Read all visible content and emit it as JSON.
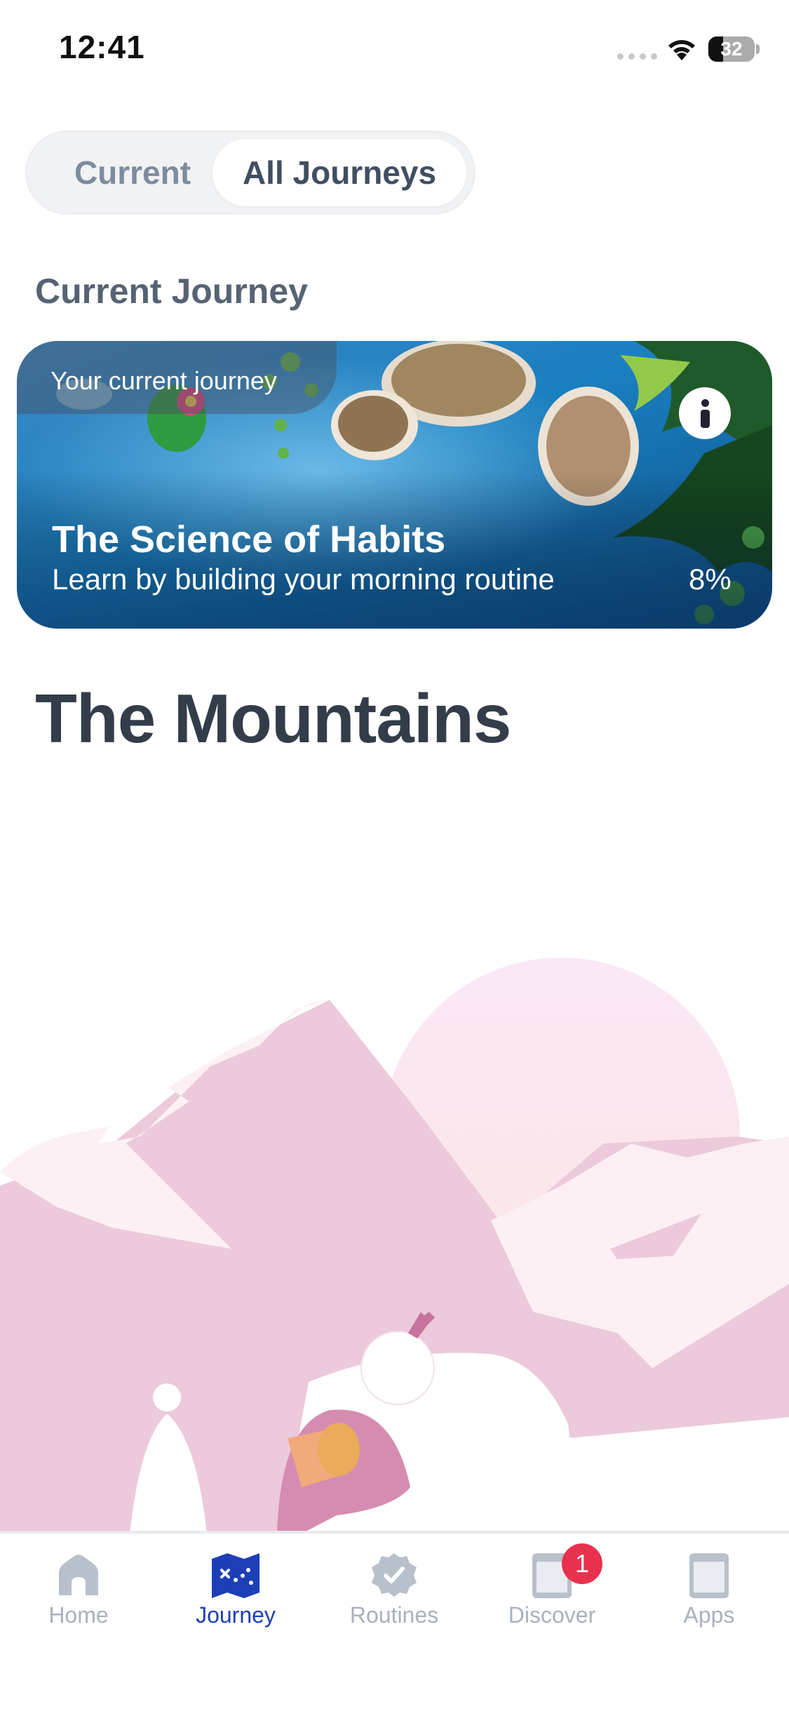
{
  "status_bar": {
    "time": "12:41",
    "battery": "32",
    "battery_level": 0.32,
    "icons": [
      "signal-dots-icon",
      "wifi-icon",
      "battery-icon"
    ]
  },
  "segmented": {
    "current_label": "Current",
    "all_label": "All Journeys",
    "selected": "All Journeys"
  },
  "section_title": "Current Journey",
  "journey_card": {
    "badge": "Your current journey",
    "title": "The Science of Habits",
    "subtitle": "Learn by building your morning routine",
    "progress": "8%",
    "info_icon": "info-icon"
  },
  "page_heading": "The Mountains",
  "tab_bar": {
    "tabs": [
      {
        "label": "Home",
        "icon": "home-icon"
      },
      {
        "label": "Journey",
        "icon": "journey-map-icon"
      },
      {
        "label": "Routines",
        "icon": "routines-check-badge-icon"
      },
      {
        "label": "Discover",
        "icon": "discover-book-icon",
        "badge": "1"
      },
      {
        "label": "Apps",
        "icon": "apps-book-icon"
      }
    ],
    "active": "Journey"
  },
  "colors": {
    "accent": "#1c3fb8",
    "badge": "#e8314f",
    "inactive_tab": "#a9b1bc",
    "heading": "#333d4a"
  }
}
